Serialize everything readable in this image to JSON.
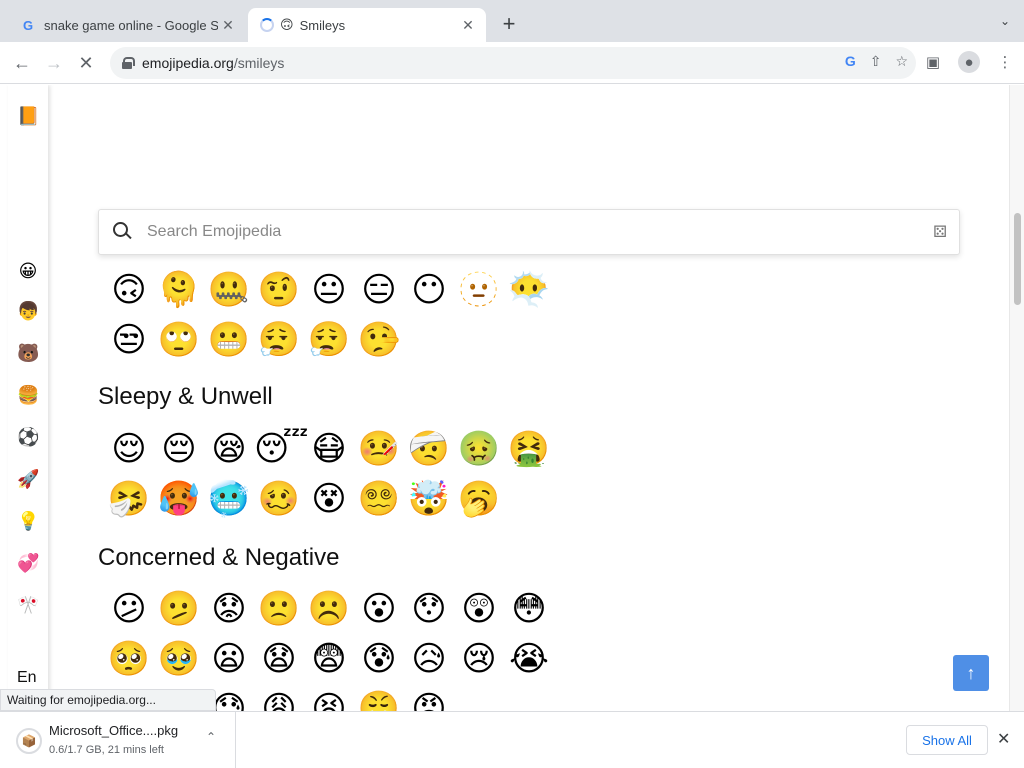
{
  "tabs": [
    {
      "title": "snake game online - Google Se",
      "favicon": "G",
      "close": "✕"
    },
    {
      "title": "Smileys",
      "favicon": "🙃",
      "close": "✕"
    }
  ],
  "new_tab_label": "+",
  "tab_menu": "⌄",
  "address": {
    "domain": "emojipedia.org",
    "path": "/smileys"
  },
  "search": {
    "placeholder": "Search Emojipedia",
    "dice": "⚄"
  },
  "sidebar": {
    "logo": "📙",
    "categories": [
      "😀",
      "👦",
      "🐻",
      "🍔",
      "⚽",
      "🚀",
      "💡",
      "💞",
      "🎌"
    ],
    "language": "En"
  },
  "sections": [
    {
      "title": "",
      "emojis": [
        "🙃",
        "🫠",
        "🤐",
        "🤨",
        "😐",
        "😑",
        "😶",
        "🫥",
        "😶‍🌫️",
        "😒",
        "🙄",
        "😬",
        "😮‍💨",
        "😮‍💨",
        "🤥"
      ]
    },
    {
      "title": "Sleepy & Unwell",
      "emojis": [
        "😌",
        "😔",
        "😪",
        "😴",
        "😷",
        "🤒",
        "🤕",
        "🤢",
        "🤮",
        "🤧",
        "🥵",
        "🥶",
        "🥴",
        "😵",
        "😵‍💫",
        "🤯",
        "🥱"
      ]
    },
    {
      "title": "Concerned & Negative",
      "emojis": [
        "😕",
        "🫤",
        "😟",
        "🙁",
        "☹️",
        "😮",
        "😯",
        "😲",
        "😳",
        "🥺",
        "🥹",
        "😦",
        "😧",
        "😨",
        "😰",
        "😥",
        "😢",
        "😭",
        "😱",
        "😖",
        "😓",
        "😩",
        "😫",
        "😤",
        "😡"
      ]
    }
  ],
  "status_text": "Waiting for emojipedia.org...",
  "download": {
    "filename": "Microsoft_Office....pkg",
    "progress": "0.6/1.7 GB, 21 mins left",
    "show_all": "Show All"
  }
}
